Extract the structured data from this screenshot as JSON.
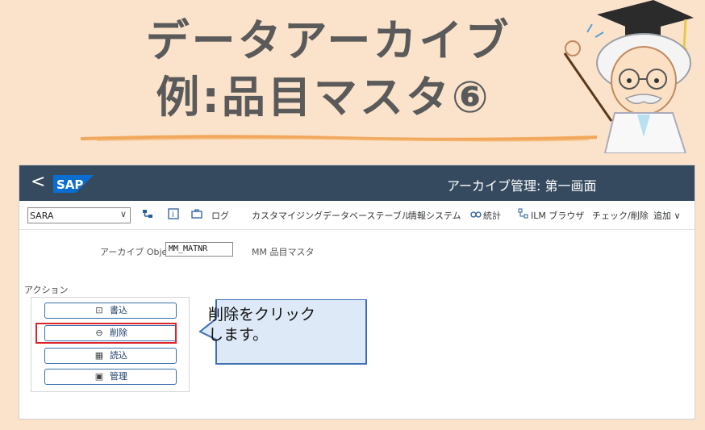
{
  "banner": {
    "title_line1": "データアーカイブ",
    "title_line2": "例:品目マスタ⑥"
  },
  "shellbar": {
    "back_glyph": "<",
    "logo_text": "SAP",
    "title": "アーカイブ管理: 第一画面"
  },
  "toolbar": {
    "tcode_value": "SARA",
    "tcode_dropdown": "∨",
    "items": {
      "log": "ログ",
      "customize": "カスタマイジング",
      "db_tables": "データベーステーブル",
      "info_system": "情報システム",
      "statistics": "統計",
      "ilm_browser": "ILM ブラウザ",
      "check_delete": "チェック/削除",
      "more": "追加 ∨"
    }
  },
  "form": {
    "object_label": "アーカイブ Object",
    "object_value": "MM_MATNR",
    "object_desc": "MM 品目マスタ",
    "actions_label": "アクション"
  },
  "actions": {
    "write": "書込",
    "delete": "削除",
    "read": "読込",
    "manage": "管理"
  },
  "callout": {
    "line1": "削除をクリック",
    "line2": "します。"
  },
  "colors": {
    "shellbar": "#354a5f",
    "highlight": "#e0222a",
    "callout_fill": "#dde9f7",
    "callout_border": "#3e6fb2",
    "page_bg": "#fbe3cb"
  }
}
